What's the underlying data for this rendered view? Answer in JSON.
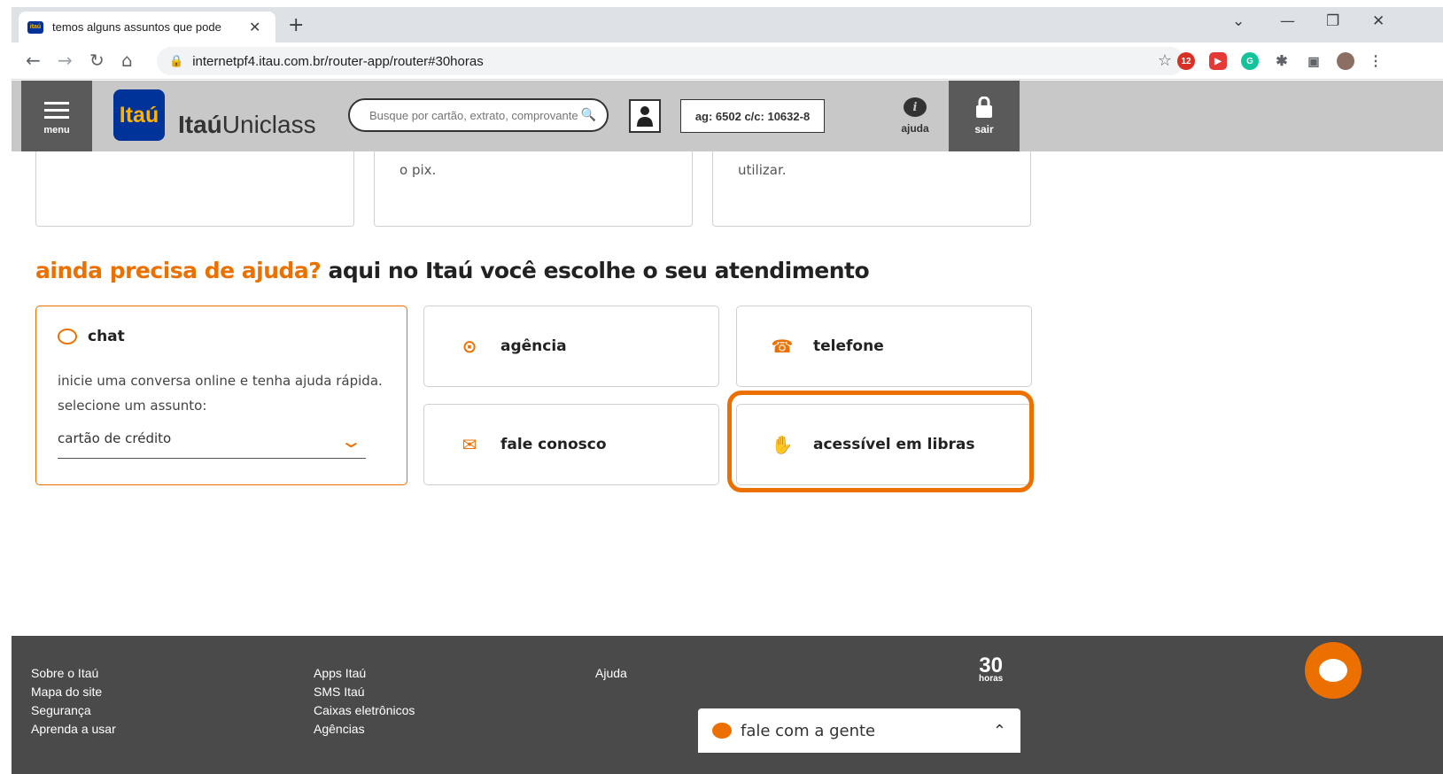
{
  "browser": {
    "tab_title": "temos alguns assuntos que pode",
    "url": "internetpf4.itau.com.br/router-app/router#30horas",
    "ext_badge": "12"
  },
  "header": {
    "menu_label": "menu",
    "logo_text": "Itaú",
    "brand_bold": "Itaú",
    "brand_light": "Uniclass",
    "search_placeholder": "Busque por cartão, extrato, comprovante",
    "account": "ag: 6502 c/c: 10632-8",
    "help_label": "ajuda",
    "exit_label": "sair"
  },
  "top_cards": [
    {
      "text": ""
    },
    {
      "text": "o pix."
    },
    {
      "text": "utilizar."
    }
  ],
  "section": {
    "title_orange": "ainda precisa de ajuda?",
    "title_rest": " aqui no Itaú você escolhe o seu atendimento"
  },
  "chat": {
    "title": "chat",
    "desc_line1": "inicie uma conversa online e tenha ajuda rápida.",
    "desc_line2": "selecione um assunto:",
    "selected": "cartão de crédito"
  },
  "options": {
    "agencia": "agência",
    "telefone": "telefone",
    "fale_conosco": "fale conosco",
    "libras": "acessível em libras"
  },
  "footer": {
    "col1": [
      "Sobre o Itaú",
      "Mapa do site",
      "Segurança",
      "Aprenda a usar"
    ],
    "col2": [
      "Apps Itaú",
      "SMS Itaú",
      "Caixas eletrônicos",
      "Agências"
    ],
    "col3": [
      "Ajuda"
    ],
    "badge_num": "30",
    "badge_word": "horas",
    "talk_label": "fale com a gente"
  },
  "colors": {
    "accent": "#ec7000",
    "brand_blue": "#003399",
    "header_gray": "#c8c8c8",
    "footer_gray": "#4a4a4a"
  }
}
